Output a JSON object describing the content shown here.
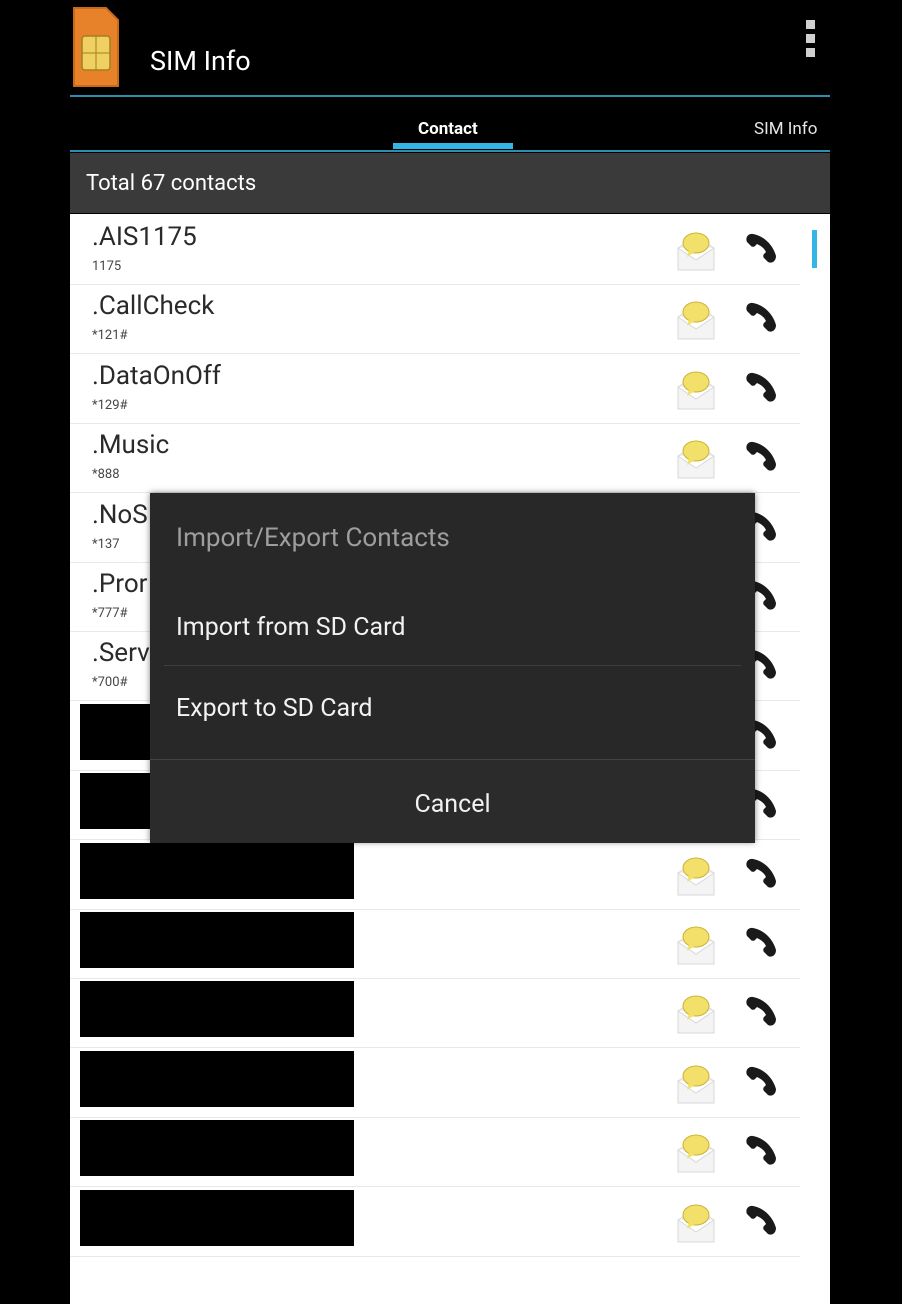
{
  "app": {
    "title": "SIM Info"
  },
  "tabs": [
    {
      "label": "Contact",
      "selected": true
    },
    {
      "label": "SIM Info",
      "selected": false
    }
  ],
  "header": {
    "total_label": "Total 67 contacts"
  },
  "contacts": [
    {
      "name": ".AIS1175",
      "number": "1175"
    },
    {
      "name": ".CallCheck",
      "number": "*121#"
    },
    {
      "name": ".DataOnOff",
      "number": "*129#"
    },
    {
      "name": ".Music",
      "number": "*888"
    },
    {
      "name": ".NoS",
      "number": "*137"
    },
    {
      "name": ".Pror",
      "number": "*777#"
    },
    {
      "name": ".Serv",
      "number": "*700#"
    },
    {
      "name": "",
      "number": "",
      "redacted": true
    },
    {
      "name": "",
      "number": "",
      "redacted": true
    },
    {
      "name": "",
      "number": "",
      "redacted": true
    },
    {
      "name": "",
      "number": "",
      "redacted": true
    },
    {
      "name": "",
      "number": "",
      "redacted": true
    },
    {
      "name": "",
      "number": "",
      "redacted": true
    },
    {
      "name": "",
      "number": "",
      "redacted": true
    },
    {
      "name": "",
      "number": "",
      "redacted": true
    }
  ],
  "dialog": {
    "title": "Import/Export Contacts",
    "items": [
      "Import from SD Card",
      "Export to SD Card"
    ],
    "cancel_label": "Cancel"
  },
  "colors": {
    "accent": "#33b5e5",
    "dialog_bg": "#282828",
    "header_bg": "#3a3a3a"
  }
}
